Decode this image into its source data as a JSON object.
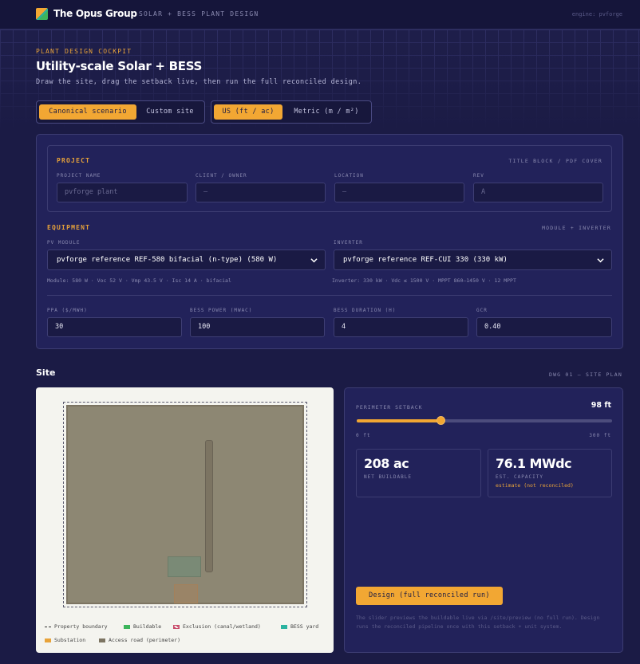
{
  "header": {
    "brand": "The Opus Group",
    "subtitle": "SOLAR + BESS PLANT DESIGN",
    "engine": "engine: pvforge"
  },
  "hero": {
    "eyebrow": "PLANT DESIGN COCKPIT",
    "title": "Utility-scale Solar + BESS",
    "lede": "Draw the site, drag the setback live, then run the full reconciled design."
  },
  "scenario_toggle": {
    "options": [
      "Canonical scenario",
      "Custom site"
    ],
    "selected": "Canonical scenario"
  },
  "units_toggle": {
    "options": [
      "US (ft / ac)",
      "Metric (m / m²)"
    ],
    "selected": "US (ft / ac)"
  },
  "project": {
    "section": "PROJECT",
    "section_right": "TITLE BLOCK / PDF COVER",
    "fields": [
      {
        "label": "PROJECT NAME",
        "placeholder": "pvforge plant"
      },
      {
        "label": "CLIENT / OWNER",
        "placeholder": "—"
      },
      {
        "label": "LOCATION",
        "placeholder": "—"
      },
      {
        "label": "REV",
        "placeholder": "A"
      }
    ]
  },
  "equipment": {
    "section": "EQUIPMENT",
    "section_right": "MODULE + INVERTER",
    "module_label": "PV MODULE",
    "module_value": "pvforge reference REF-580 bifacial (n-type) (580 W)",
    "module_spec": "Module: 580 W · Voc 52 V · Vmp 43.5 V · Isc 14 A · bifacial",
    "inverter_label": "INVERTER",
    "inverter_value": "pvforge reference REF-CUI 330 (330 kW)",
    "inverter_spec": "Inverter: 330 kW · Vdc ≤ 1500 V · MPPT 860–1450 V · 12 MPPT"
  },
  "params": [
    {
      "label": "PPA ($/MWH)",
      "value": "30"
    },
    {
      "label": "BESS POWER (MWAC)",
      "value": "100"
    },
    {
      "label": "BESS DURATION (H)",
      "value": "4"
    },
    {
      "label": "GCR",
      "value": "0.40"
    }
  ],
  "site": {
    "title": "Site",
    "dwg": "DWG 01 — SITE PLAN",
    "legend": [
      {
        "label": "Property boundary",
        "color": "#333333"
      },
      {
        "label": "Buildable",
        "color": "#3cb55c"
      },
      {
        "label": "Exclusion (canal/wetland)",
        "color": "#c94a6a"
      },
      {
        "label": "BESS yard",
        "color": "#2bb3a0"
      },
      {
        "label": "Substation",
        "color": "#e8a33a"
      },
      {
        "label": "Access road (perimeter)",
        "color": "#7c7462"
      }
    ]
  },
  "controls": {
    "setback_label": "PERIMETER SETBACK",
    "setback_value": "98 ft",
    "setback_fraction": 0.33,
    "range_min": "0 ft",
    "range_max": "300 ft",
    "net_buildable": "208 ac",
    "net_buildable_label": "NET BUILDABLE",
    "capacity": "76.1 MWdc",
    "capacity_label": "EST. CAPACITY",
    "capacity_note": "estimate (not reconciled)",
    "design_button": "Design (full reconciled run)",
    "footnote": "The slider previews the buildable live via /site/preview (no full run). Design runs the reconciled pipeline once with this setback + unit system."
  },
  "colors": {
    "accent": "#f2a733",
    "bg": "#1b1b45",
    "panel": "#22225a"
  }
}
